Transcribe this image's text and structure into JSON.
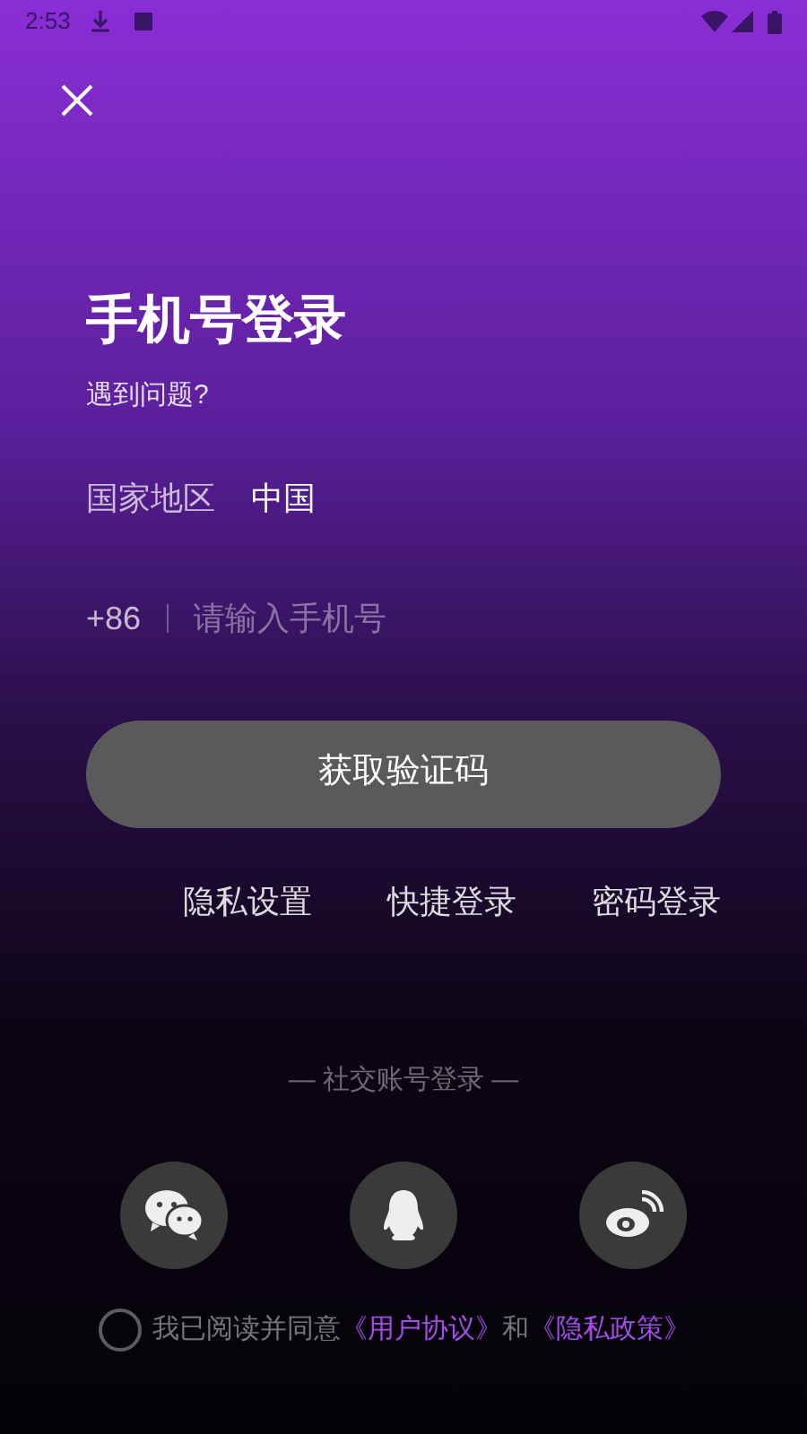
{
  "status_bar": {
    "time": "2:53"
  },
  "title": "手机号登录",
  "help_link": "遇到问题?",
  "region": {
    "label": "国家地区",
    "value": "中国"
  },
  "phone": {
    "prefix": "+86",
    "placeholder": "请输入手机号"
  },
  "submit_button": "获取验证码",
  "links": [
    "隐私设置",
    "快捷登录",
    "密码登录"
  ],
  "social": {
    "heading": "— 社交账号登录 —",
    "buttons": [
      {
        "kind": "wechat"
      },
      {
        "kind": "qq"
      },
      {
        "kind": "weibo"
      }
    ]
  },
  "agreement": {
    "checked": false,
    "text": "我已阅读并同意",
    "links": [
      "《用户协议》",
      "《隐私政策》"
    ],
    "joiner": "和"
  }
}
